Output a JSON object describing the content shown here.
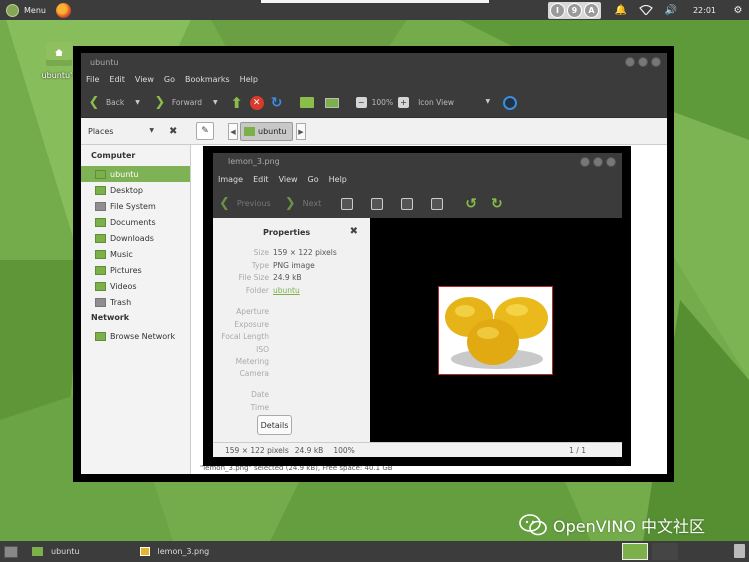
{
  "top_panel": {
    "menu_label": "Menu",
    "keyboard_indicators": [
      "I",
      "9",
      "A"
    ],
    "clock": "22:01"
  },
  "desktop": {
    "home_icon_label": "ubuntu's"
  },
  "file_manager": {
    "title": "ubuntu",
    "menu": [
      "File",
      "Edit",
      "View",
      "Go",
      "Bookmarks",
      "Help"
    ],
    "toolbar": {
      "back": "Back",
      "forward": "Forward",
      "zoom": "100%",
      "view_mode": "Icon View"
    },
    "places_label": "Places",
    "breadcrumb": "ubuntu",
    "sidebar": {
      "computer_header": "Computer",
      "computer_items": [
        "ubuntu",
        "Desktop",
        "File System",
        "Documents",
        "Downloads",
        "Music",
        "Pictures",
        "Videos",
        "Trash"
      ],
      "network_header": "Network",
      "network_items": [
        "Browse Network"
      ]
    },
    "status": "\"lemon_3.png\" selected (24.9 kB), Free space: 40.1 GB"
  },
  "image_viewer": {
    "title": "lemon_3.png",
    "menu": [
      "Image",
      "Edit",
      "View",
      "Go",
      "Help"
    ],
    "toolbar": {
      "previous": "Previous",
      "next": "Next"
    },
    "properties": {
      "title": "Properties",
      "rows": [
        {
          "label": "Size",
          "value": "159 × 122 pixels"
        },
        {
          "label": "Type",
          "value": "PNG image"
        },
        {
          "label": "File Size",
          "value": "24.9 kB"
        },
        {
          "label": "Folder",
          "value": "ubuntu"
        },
        {
          "label": "Aperture",
          "value": ""
        },
        {
          "label": "Exposure",
          "value": ""
        },
        {
          "label": "Focal Length",
          "value": ""
        },
        {
          "label": "ISO",
          "value": ""
        },
        {
          "label": "Metering",
          "value": ""
        },
        {
          "label": "Camera",
          "value": ""
        },
        {
          "label": "Date",
          "value": ""
        },
        {
          "label": "Time",
          "value": ""
        }
      ],
      "details_button": "Details"
    },
    "status": {
      "dimensions": "159 × 122 pixels",
      "size": "24.9 kB",
      "zoom": "100%",
      "pages": "1 / 1"
    }
  },
  "watermark": {
    "text": "OpenVINO 中文社区"
  },
  "taskbar": {
    "tasks": [
      "ubuntu",
      "lemon_3.png"
    ]
  }
}
